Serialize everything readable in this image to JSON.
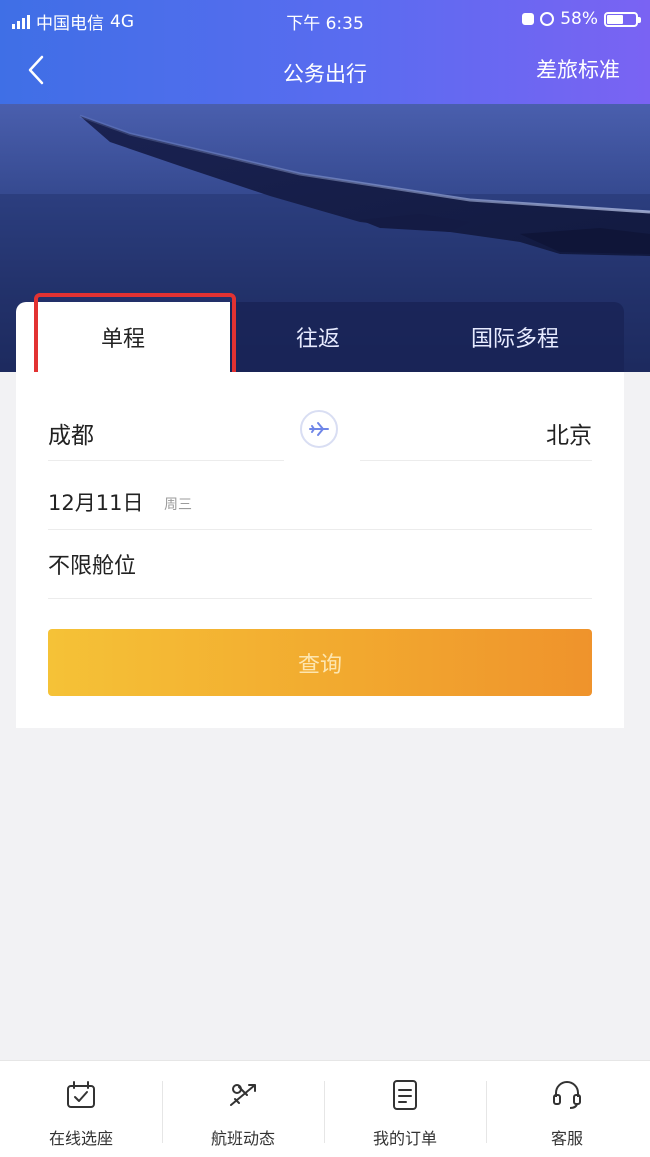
{
  "status_bar": {
    "carrier": "中国电信",
    "network": "4G",
    "time": "下午 6:35",
    "battery": "58%",
    "battery_level": 0.58
  },
  "nav": {
    "title": "公务出行",
    "right_link": "差旅标准",
    "back_icon": "chevron-left-icon"
  },
  "tabs": [
    {
      "label": "单程",
      "active": true
    },
    {
      "label": "往返",
      "active": false
    },
    {
      "label": "国际多程",
      "active": false
    }
  ],
  "search": {
    "from_city": "成都",
    "to_city": "北京",
    "swap_icon": "plane-swap-icon",
    "date": "12月11日",
    "weekday": "周三",
    "cabin": "不限舱位",
    "query_label": "查询"
  },
  "bottom_nav": [
    {
      "label": "在线选座",
      "icon": "seat-check-icon"
    },
    {
      "label": "航班动态",
      "icon": "plane-status-icon"
    },
    {
      "label": "我的订单",
      "icon": "order-document-icon"
    },
    {
      "label": "客服",
      "icon": "headset-icon"
    }
  ],
  "colors": {
    "header_gradient_start": "#3f6fe6",
    "header_gradient_end": "#7a63f3",
    "query_button": "#f2a92f",
    "highlight_box": "#e23232"
  }
}
